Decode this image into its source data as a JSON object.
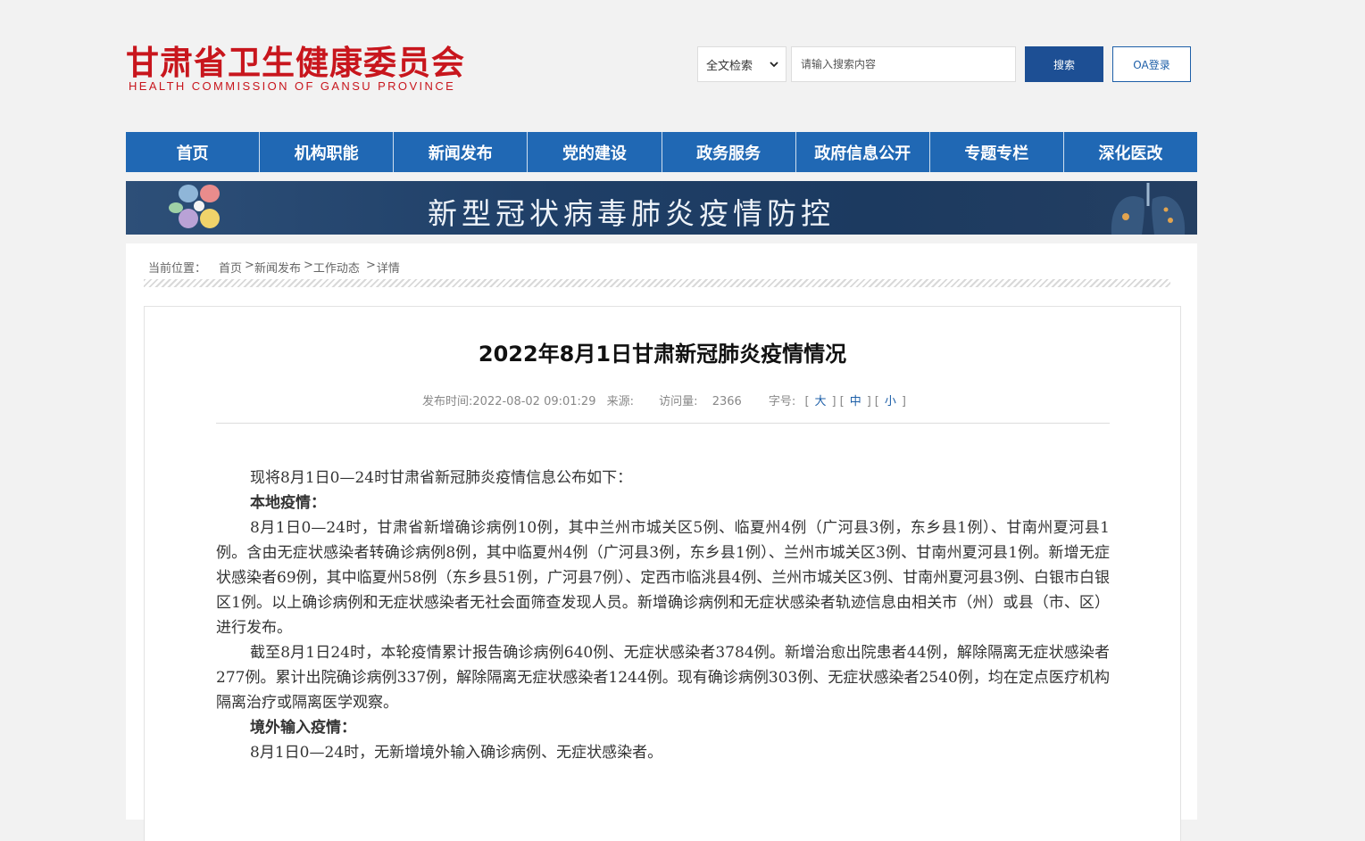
{
  "header": {
    "logo_cn": "甘肃省卫生健康委员会",
    "logo_en": "HEALTH  COMMISSION  OF  GANSU PROVINCE",
    "search_scope": "全文检索",
    "search_placeholder": "请输入搜索内容",
    "search_button": "搜索",
    "oa_button": "OA登录"
  },
  "nav": {
    "items": [
      "首页",
      "机构职能",
      "新闻发布",
      "党的建设",
      "政务服务",
      "政府信息公开",
      "专题专栏",
      "深化医改"
    ]
  },
  "banner": {
    "title": "新型冠状病毒肺炎疫情防控"
  },
  "breadcrumb": {
    "label": "当前位置：",
    "items": [
      "首页",
      "新闻发布",
      "工作动态",
      "详情"
    ]
  },
  "article": {
    "title": "2022年8月1日甘肃新冠肺炎疫情情况",
    "publish_label": "发布时间:",
    "publish_time": "2022-08-02 09:01:29",
    "source_label": "来源:",
    "views_label": "访问量:",
    "views": "2366",
    "fontsize_label": "字号:",
    "fontsize_large": "大",
    "fontsize_medium": "中",
    "fontsize_small": "小",
    "paragraphs": [
      {
        "text": "现将8月1日0—24时甘肃省新冠肺炎疫情信息公布如下：",
        "bold": false
      },
      {
        "text": "本地疫情：",
        "bold": true
      },
      {
        "text": "8月1日0—24时，甘肃省新增确诊病例10例，其中兰州市城关区5例、临夏州4例（广河县3例，东乡县1例）、甘南州夏河县1例。含由无症状感染者转确诊病例8例，其中临夏州4例（广河县3例，东乡县1例）、兰州市城关区3例、甘南州夏河县1例。新增无症状感染者69例，其中临夏州58例（东乡县51例，广河县7例）、定西市临洮县4例、兰州市城关区3例、甘南州夏河县3例、白银市白银区1例。以上确诊病例和无症状感染者无社会面筛查发现人员。新增确诊病例和无症状感染者轨迹信息由相关市（州）或县（市、区）进行发布。",
        "bold": false
      },
      {
        "text": "截至8月1日24时，本轮疫情累计报告确诊病例640例、无症状感染者3784例。新增治愈出院患者44例，解除隔离无症状感染者277例。累计出院确诊病例337例，解除隔离无症状感染者1244例。现有确诊病例303例、无症状感染者2540例，均在定点医疗机构隔离治疗或隔离医学观察。",
        "bold": false
      },
      {
        "text": "境外输入疫情：",
        "bold": true
      },
      {
        "text": "8月1日0—24时，无新增境外输入确诊病例、无症状感染者。",
        "bold": false
      }
    ]
  },
  "colors": {
    "brand_red": "#c8161d",
    "nav_blue": "#2068b4",
    "button_blue": "#1d4f94"
  }
}
